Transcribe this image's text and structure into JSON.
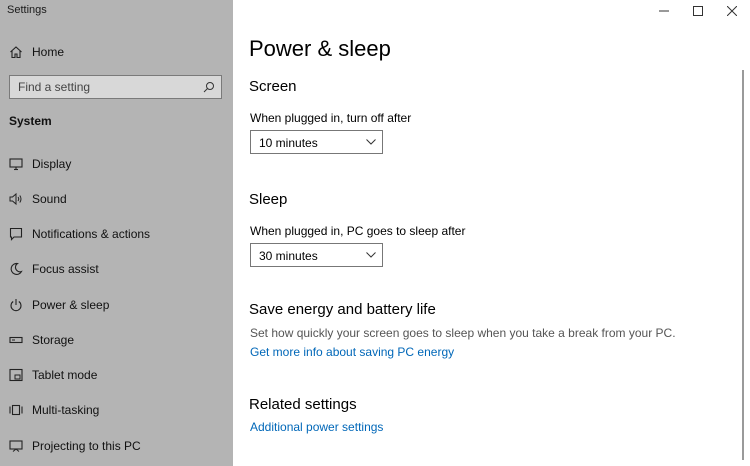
{
  "window": {
    "app_title": "Settings"
  },
  "sidebar": {
    "home_label": "Home",
    "search": {
      "placeholder": "Find a setting"
    },
    "section_title": "System",
    "items": [
      {
        "label": "Display",
        "icon": "monitor-icon"
      },
      {
        "label": "Sound",
        "icon": "speaker-icon"
      },
      {
        "label": "Notifications & actions",
        "icon": "notification-icon"
      },
      {
        "label": "Focus assist",
        "icon": "moon-icon"
      },
      {
        "label": "Power & sleep",
        "icon": "power-icon"
      },
      {
        "label": "Storage",
        "icon": "storage-icon"
      },
      {
        "label": "Tablet mode",
        "icon": "tablet-icon"
      },
      {
        "label": "Multi-tasking",
        "icon": "multitask-icon"
      },
      {
        "label": "Projecting to this PC",
        "icon": "project-icon"
      }
    ]
  },
  "main": {
    "title": "Power & sleep",
    "screen": {
      "heading": "Screen",
      "label": "When plugged in, turn off after",
      "value": "10 minutes"
    },
    "sleep": {
      "heading": "Sleep",
      "label": "When plugged in, PC goes to sleep after",
      "value": "30 minutes"
    },
    "save_energy": {
      "heading": "Save energy and battery life",
      "description": "Set how quickly your screen goes to sleep when you take a break from your PC.",
      "link": "Get more info about saving PC energy"
    },
    "related": {
      "heading": "Related settings",
      "link": "Additional power settings"
    }
  },
  "colors": {
    "sidebar_bg": "#b4b4b4",
    "link": "#0067b8"
  }
}
